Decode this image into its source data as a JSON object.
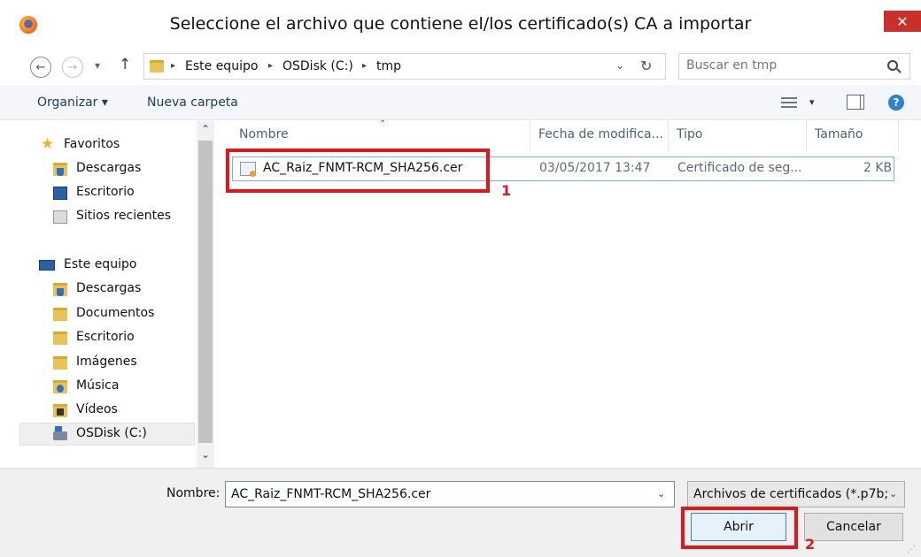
{
  "window": {
    "title": "Seleccione el archivo que contiene el/los certificado(s) CA a importar",
    "close_glyph": "✕"
  },
  "navigation": {
    "back_glyph": "←",
    "forward_glyph": "→",
    "recent_glyph": "▾",
    "up_glyph": "↑",
    "breadcrumb": [
      "Este equipo",
      "OSDisk (C:)",
      "tmp"
    ],
    "separator_glyph": "▸",
    "address_dropdown_glyph": "⌄",
    "refresh_glyph": "↻",
    "search_placeholder": "Buscar en tmp"
  },
  "toolbar": {
    "organize_label": "Organizar ▾",
    "new_folder_label": "Nueva carpeta",
    "view_dropdown_glyph": "▾",
    "help_glyph": "?"
  },
  "sidebar": {
    "favorites_label": "Favoritos",
    "favorites": [
      "Descargas",
      "Escritorio",
      "Sitios recientes"
    ],
    "this_pc_label": "Este equipo",
    "this_pc_items": [
      "Descargas",
      "Documentos",
      "Escritorio",
      "Imágenes",
      "Música",
      "Vídeos",
      "OSDisk (C:)"
    ],
    "selected": "OSDisk (C:)",
    "scroll_up_glyph": "⌃",
    "scroll_down_glyph": "⌄"
  },
  "file_list": {
    "columns": [
      "Nombre",
      "Fecha de modifica...",
      "Tipo",
      "Tamaño"
    ],
    "sort_glyph": "⌃",
    "rows": [
      {
        "name": "AC_Raiz_FNMT-RCM_SHA256.cer",
        "modified": "03/05/2017 13:47",
        "type": "Certificado de seg...",
        "size": "2 KB",
        "icon": "certificate-icon"
      }
    ]
  },
  "footer": {
    "filename_label": "Nombre:",
    "filename_value": "AC_Raiz_FNMT-RCM_SHA256.cer",
    "filename_dropdown_glyph": "⌄",
    "filetype_value": "Archivos de certificados (*.p7b;",
    "filetype_dropdown_glyph": "⌄",
    "open_label": "Abrir",
    "cancel_label": "Cancelar",
    "resize_glyph": "⋰"
  },
  "annotations": [
    {
      "label": "1",
      "color": "#e0161b"
    },
    {
      "label": "2",
      "color": "#e0161b"
    }
  ]
}
